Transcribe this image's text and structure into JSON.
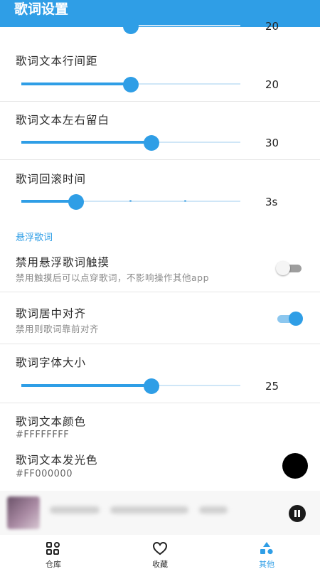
{
  "appbar": {
    "title": "歌词设置"
  },
  "top_slider": {
    "value": "20",
    "fraction": 0.5
  },
  "line_spacing": {
    "label": "歌词文本行间距",
    "value": "20",
    "fraction": 0.5
  },
  "side_margin": {
    "label": "歌词文本左右留白",
    "value": "30",
    "fraction": 0.595
  },
  "scroll_time": {
    "label": "歌词回滚时间",
    "value": "3s",
    "fraction": 0.25,
    "ticks": 4
  },
  "floating_section": {
    "title": "悬浮歌词"
  },
  "disable_touch": {
    "label": "禁用悬浮歌词触摸",
    "sub": "禁用触摸后可以点穿歌词，不影响操作其他app",
    "on": false
  },
  "center_align": {
    "label": "歌词居中对齐",
    "sub": "禁用则歌词靠前对齐",
    "on": true
  },
  "font_size": {
    "label": "歌词字体大小",
    "value": "25",
    "fraction": 0.595
  },
  "text_color": {
    "label": "歌词文本颜色",
    "value": "#FFFFFFFF",
    "color": "#FFFFFF"
  },
  "glow_color": {
    "label": "歌词文本发光色",
    "value": "#FF000000",
    "color": "#000000"
  },
  "player": {
    "state": "playing",
    "icon": "pause-icon"
  },
  "nav": {
    "items": [
      {
        "label": "仓库",
        "icon": "grid-icon"
      },
      {
        "label": "收藏",
        "icon": "heart-icon"
      },
      {
        "label": "其他",
        "icon": "shapes-icon",
        "active": true
      }
    ]
  },
  "colors": {
    "accent": "#2f9ee6"
  }
}
